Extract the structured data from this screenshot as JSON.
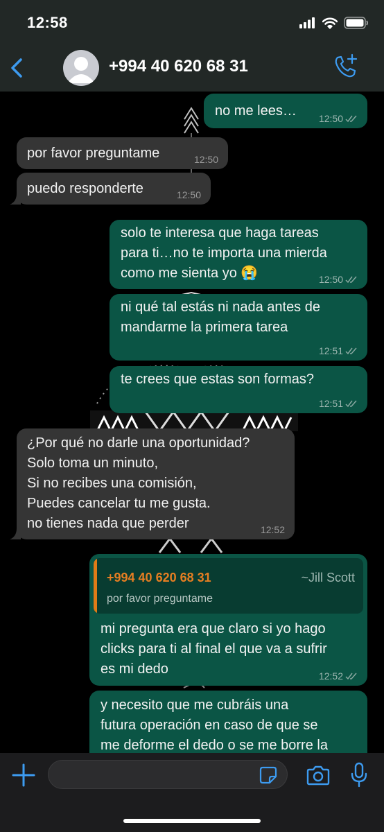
{
  "status_bar": {
    "time": "12:58"
  },
  "header": {
    "contact": "+994 40 620 68 31"
  },
  "messages": [
    {
      "dir": "out",
      "text": "no me lees…",
      "time": "12:50"
    },
    {
      "dir": "in",
      "text": "por favor preguntame",
      "time": "12:50"
    },
    {
      "dir": "in",
      "text": "puedo responderte",
      "time": "12:50"
    },
    {
      "dir": "out",
      "lines": [
        "solo te interesa que haga tareas",
        "para ti…no te importa una mierda",
        "como me sienta yo 😭"
      ],
      "time": "12:50"
    },
    {
      "dir": "out",
      "lines": [
        "ni qué tal estás ni nada antes de",
        "mandarme la primera tarea"
      ],
      "time": "12:51"
    },
    {
      "dir": "out",
      "text": "te crees que estas son formas?",
      "time": "12:51"
    },
    {
      "dir": "in",
      "lines": [
        "¿Por qué no darle una oportunidad?",
        "Solo toma un minuto,",
        "Si no recibes una comisión,",
        "Puedes cancelar tu me gusta.",
        "no tienes nada que perder"
      ],
      "time": "12:52"
    },
    {
      "dir": "out",
      "quote": {
        "name": "+994 40 620 68 31",
        "alias": "~Jill Scott",
        "text": "por favor preguntame"
      },
      "lines": [
        "mi pregunta era que claro si yo hago",
        "clicks para ti al final el que va a sufrir",
        "es mi dedo"
      ],
      "time": "12:52"
    },
    {
      "dir": "out",
      "lines": [
        "y necesito que me cubráis una",
        "futura operación en caso de que se",
        "me deforme el dedo o se me borre la"
      ]
    }
  ],
  "colors": {
    "outgoing": "#0b5545",
    "incoming": "#353535",
    "accent": "#3d9bf0",
    "quote_name": "#e67e22"
  },
  "icons": [
    "back-chevron-icon",
    "call-add-icon",
    "plus-icon",
    "sticker-icon",
    "camera-icon",
    "mic-icon",
    "signal-icon",
    "wifi-icon",
    "battery-icon"
  ]
}
